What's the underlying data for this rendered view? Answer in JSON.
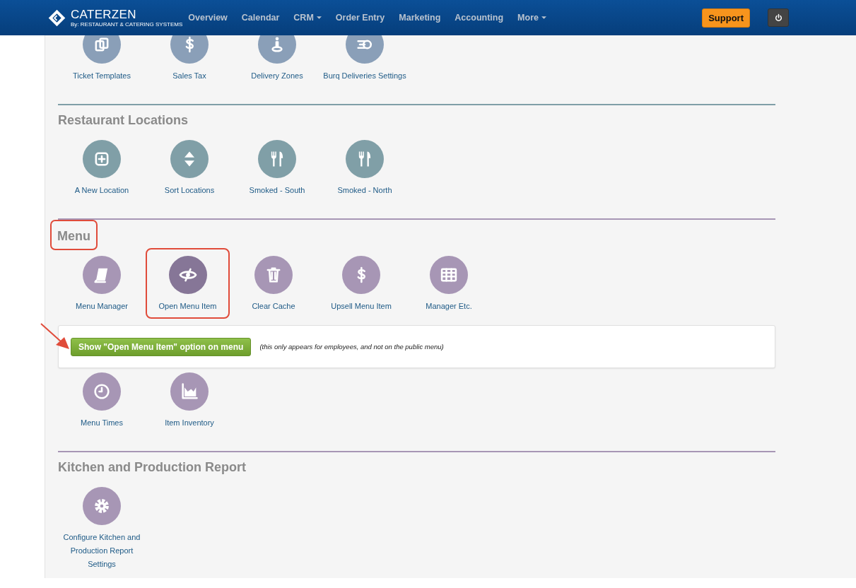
{
  "navbar": {
    "logo": {
      "name": "CATERZEN",
      "tagline": "By: RESTAURANT & CATERING SYSTEMS"
    },
    "items": [
      {
        "label": "Overview",
        "dropdown": false
      },
      {
        "label": "Calendar",
        "dropdown": false
      },
      {
        "label": "CRM",
        "dropdown": true
      },
      {
        "label": "Order Entry",
        "dropdown": false
      },
      {
        "label": "Marketing",
        "dropdown": false
      },
      {
        "label": "Accounting",
        "dropdown": false
      },
      {
        "label": "More",
        "dropdown": true
      }
    ],
    "support_button": "Support"
  },
  "sections": [
    {
      "color": "#8a9fb8",
      "blocks": [
        {
          "kind": "tiles",
          "tiles": [
            {
              "label": "Ticket Templates",
              "selected": false
            },
            {
              "label": "Sales Tax",
              "selected": false
            },
            {
              "label": "Delivery Zones",
              "selected": false
            },
            {
              "label": "Burq Deliveries Settings",
              "selected": false
            }
          ]
        }
      ]
    },
    {
      "title": "Restaurant Locations",
      "color": "#809fa7",
      "blocks": [
        {
          "kind": "tiles",
          "tiles": [
            {
              "label": "A New Location",
              "selected": false
            },
            {
              "label": "Sort Locations",
              "selected": false
            },
            {
              "label": "Smoked - South",
              "selected": false
            },
            {
              "label": "Smoked - North",
              "selected": false
            }
          ]
        }
      ]
    },
    {
      "title": "Menu",
      "color": "#a796b5",
      "annotated": true,
      "blocks": [
        {
          "kind": "tiles",
          "tiles": [
            {
              "label": "Menu Manager",
              "selected": false
            },
            {
              "label": "Open Menu Item",
              "selected": true,
              "annotated": true
            },
            {
              "label": "Clear Cache",
              "selected": false
            },
            {
              "label": "Upsell Menu Item",
              "selected": false
            },
            {
              "label": "Manager Etc.",
              "selected": false
            }
          ]
        },
        {
          "kind": "notice",
          "button": "Show \"Open Menu Item\" option on menu",
          "note": "(this only appears for employees, and not on the public menu)",
          "arrow": true
        },
        {
          "kind": "tiles",
          "tiles": [
            {
              "label": "Menu Times",
              "selected": false
            },
            {
              "label": "Item Inventory",
              "selected": false
            }
          ]
        }
      ]
    },
    {
      "title": "Kitchen and Production Report",
      "color": "#a796b5",
      "blocks": [
        {
          "kind": "tiles",
          "tiles": [
            {
              "label": "Configure Kitchen and Production Report Settings",
              "selected": false
            }
          ]
        }
      ]
    }
  ]
}
